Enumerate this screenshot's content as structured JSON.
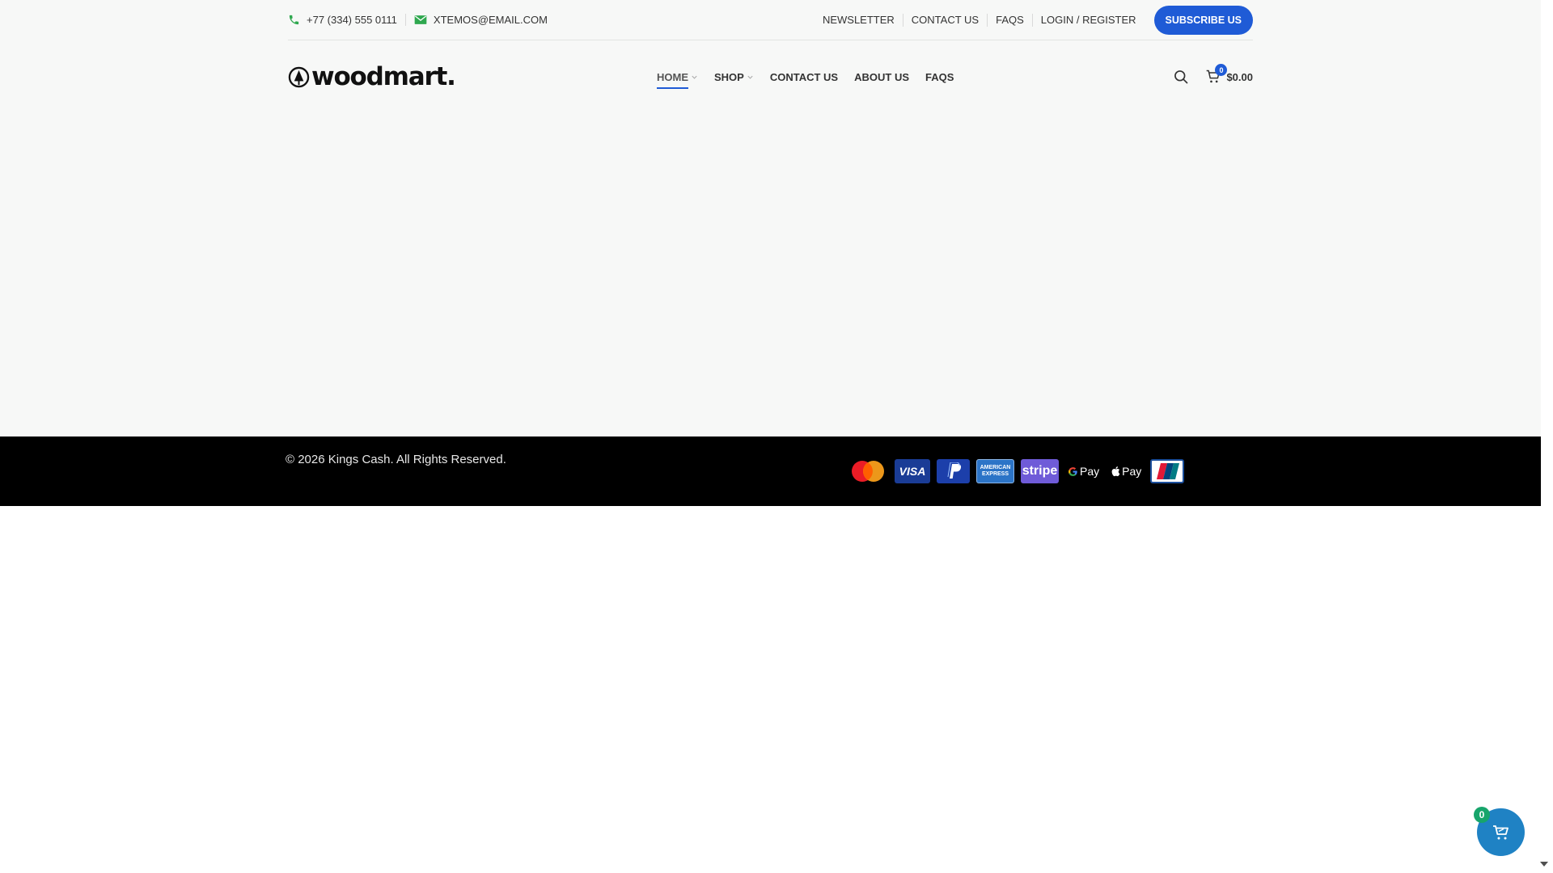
{
  "topbar": {
    "phone": "+77 (334) 555 0111",
    "email": "XTEMOS@EMAIL.COM",
    "links": [
      "NEWSLETTER",
      "CONTACT US",
      "FAQS",
      "LOGIN / REGISTER"
    ],
    "subscribe_label": "SUBSCRIBE US"
  },
  "header": {
    "logo_text": "woodmart.",
    "nav": [
      {
        "label": "HOME",
        "has_dropdown": true,
        "active": true
      },
      {
        "label": "SHOP",
        "has_dropdown": true,
        "active": false
      },
      {
        "label": "CONTACT US",
        "has_dropdown": false,
        "active": false
      },
      {
        "label": "ABOUT US",
        "has_dropdown": false,
        "active": false
      },
      {
        "label": "FAQS",
        "has_dropdown": false,
        "active": false
      }
    ],
    "cart_count": "0",
    "cart_total": "$0.00"
  },
  "footer": {
    "copyright": "© 2026 Kings Cash. All Rights Reserved.",
    "payment_icons": [
      "mastercard-icon",
      "visa-icon",
      "paypal-icon",
      "amex-icon",
      "stripe-icon",
      "google-pay-icon",
      "apple-pay-icon",
      "unionpay-icon"
    ],
    "visa_text": "VISA",
    "amex_text": "AMERICAN EXPRESS",
    "stripe_text": "stripe",
    "gpay_text": "Pay",
    "apay_text": "Pay"
  },
  "floating_cart": {
    "count": "0"
  },
  "colors": {
    "accent": "#1f5bd6",
    "topbar_icon": "#2fa84f",
    "footer_bg": "#000000",
    "float_cart": "#1f82c4",
    "float_badge": "#17a56b"
  }
}
